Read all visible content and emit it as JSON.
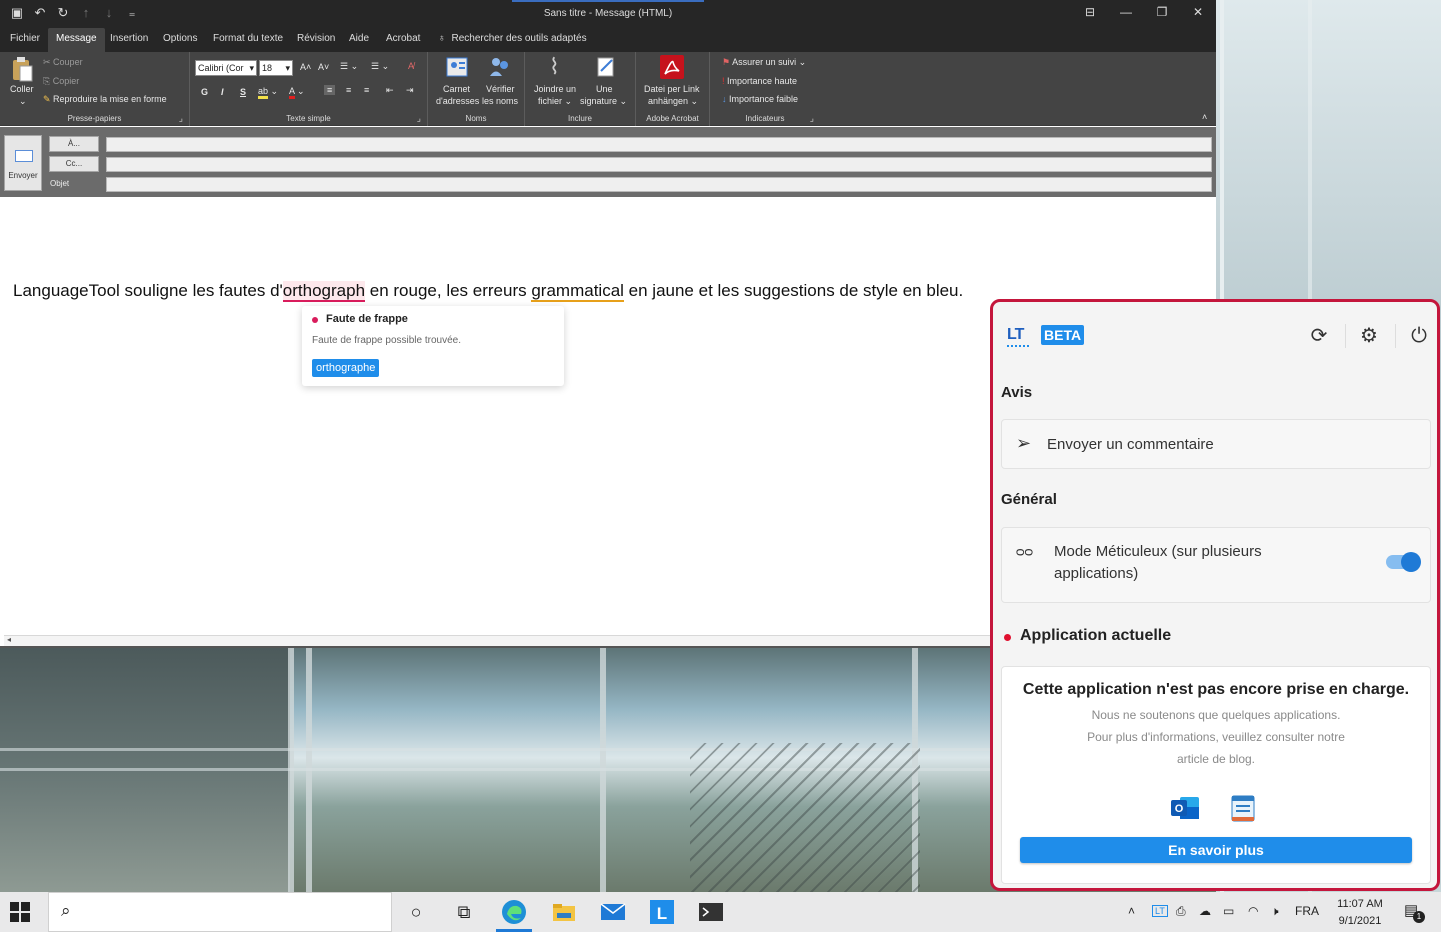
{
  "outlook": {
    "title": "Sans titre  -  Message (HTML)",
    "qat_icons": [
      "save-icon",
      "undo-icon",
      "redo-icon",
      "up-arrow-icon",
      "down-arrow-icon",
      "customize-icon"
    ],
    "window_controls": [
      "ribbon-display-icon",
      "minimize-icon",
      "maximize-icon",
      "close-icon"
    ],
    "menu": [
      "Fichier",
      "Message",
      "Insertion",
      "Options",
      "Format du texte",
      "Révision",
      "Aide",
      "Acrobat"
    ],
    "active_menu": "Message",
    "search_tools": "Rechercher des outils adaptés",
    "ribbon": {
      "clipboard": {
        "paste": "Coller",
        "cut": "Couper",
        "copy": "Copier",
        "format_painter": "Reproduire la mise en forme",
        "label": "Presse-papiers"
      },
      "basic_text": {
        "font": "Calibri (Cor",
        "size": "18",
        "bold": "G",
        "italic": "I",
        "underline": "S",
        "label": "Texte simple"
      },
      "names": {
        "address_book_line1": "Carnet",
        "address_book_line2": "d'adresses",
        "check_names_line1": "Vérifier",
        "check_names_line2": "les noms",
        "label": "Noms"
      },
      "include": {
        "attach_line1": "Joindre un",
        "attach_line2": "fichier",
        "signature_line1": "Une",
        "signature_line2": "signature",
        "label": "Inclure"
      },
      "acrobat": {
        "link_line1": "Datei per Link",
        "link_line2": "anhängen",
        "label": "Adobe Acrobat"
      },
      "tags": {
        "follow_up": "Assurer un suivi",
        "high": "Importance haute",
        "low": "Importance faible",
        "label": "Indicateurs"
      }
    },
    "compose": {
      "send": "Envoyer",
      "to": "À...",
      "cc": "Cc...",
      "subject": "Objet"
    },
    "body": {
      "part1": "LanguageTool souligne les fautes d'",
      "spell_error": "orthograph",
      "part2": " en rouge, les erreurs ",
      "grammar_error": "grammatical",
      "part3": " en jaune et les suggestions de style en bleu."
    },
    "tooltip": {
      "title": "Faute de frappe",
      "description": "Faute de frappe possible trouvée.",
      "suggestion": "orthographe"
    }
  },
  "lt_panel": {
    "logo": "LT",
    "beta": "BETA",
    "header_icons": [
      "refresh-icon",
      "settings-icon",
      "power-icon"
    ],
    "feedback_section": "Avis",
    "feedback_button": "Envoyer un commentaire",
    "general_section": "Général",
    "picky_mode_line1": "Mode Méticuleux (sur plusieurs",
    "picky_mode_line2": "applications)",
    "picky_mode_on": true,
    "current_app_section": "Application actuelle",
    "unsupported_title": "Cette application n'est pas encore prise en charge.",
    "unsupported_line1": "Nous ne soutenons que quelques applications.",
    "unsupported_line2": "Pour plus d'informations, veuillez consulter notre",
    "unsupported_line3": "article de blog.",
    "supported_apps": [
      "outlook-icon",
      "notepad-icon"
    ],
    "learn_more": "En savoir plus",
    "accent": "#1f8dea",
    "frame_color": "#c4163c"
  },
  "taskbar": {
    "pinned": [
      "cortana-icon",
      "task-view-icon",
      "edge-icon",
      "file-explorer-icon",
      "mail-icon",
      "languagetool-icon",
      "terminal-icon"
    ],
    "tray_icons": [
      "chevron-up-icon",
      "lt-tray-icon",
      "meet-icon",
      "onedrive-icon",
      "battery-icon",
      "wifi-icon",
      "volume-mute-icon"
    ],
    "language": "FRA",
    "time": "11:07 AM",
    "date": "9/1/2021",
    "notifications": "1"
  }
}
